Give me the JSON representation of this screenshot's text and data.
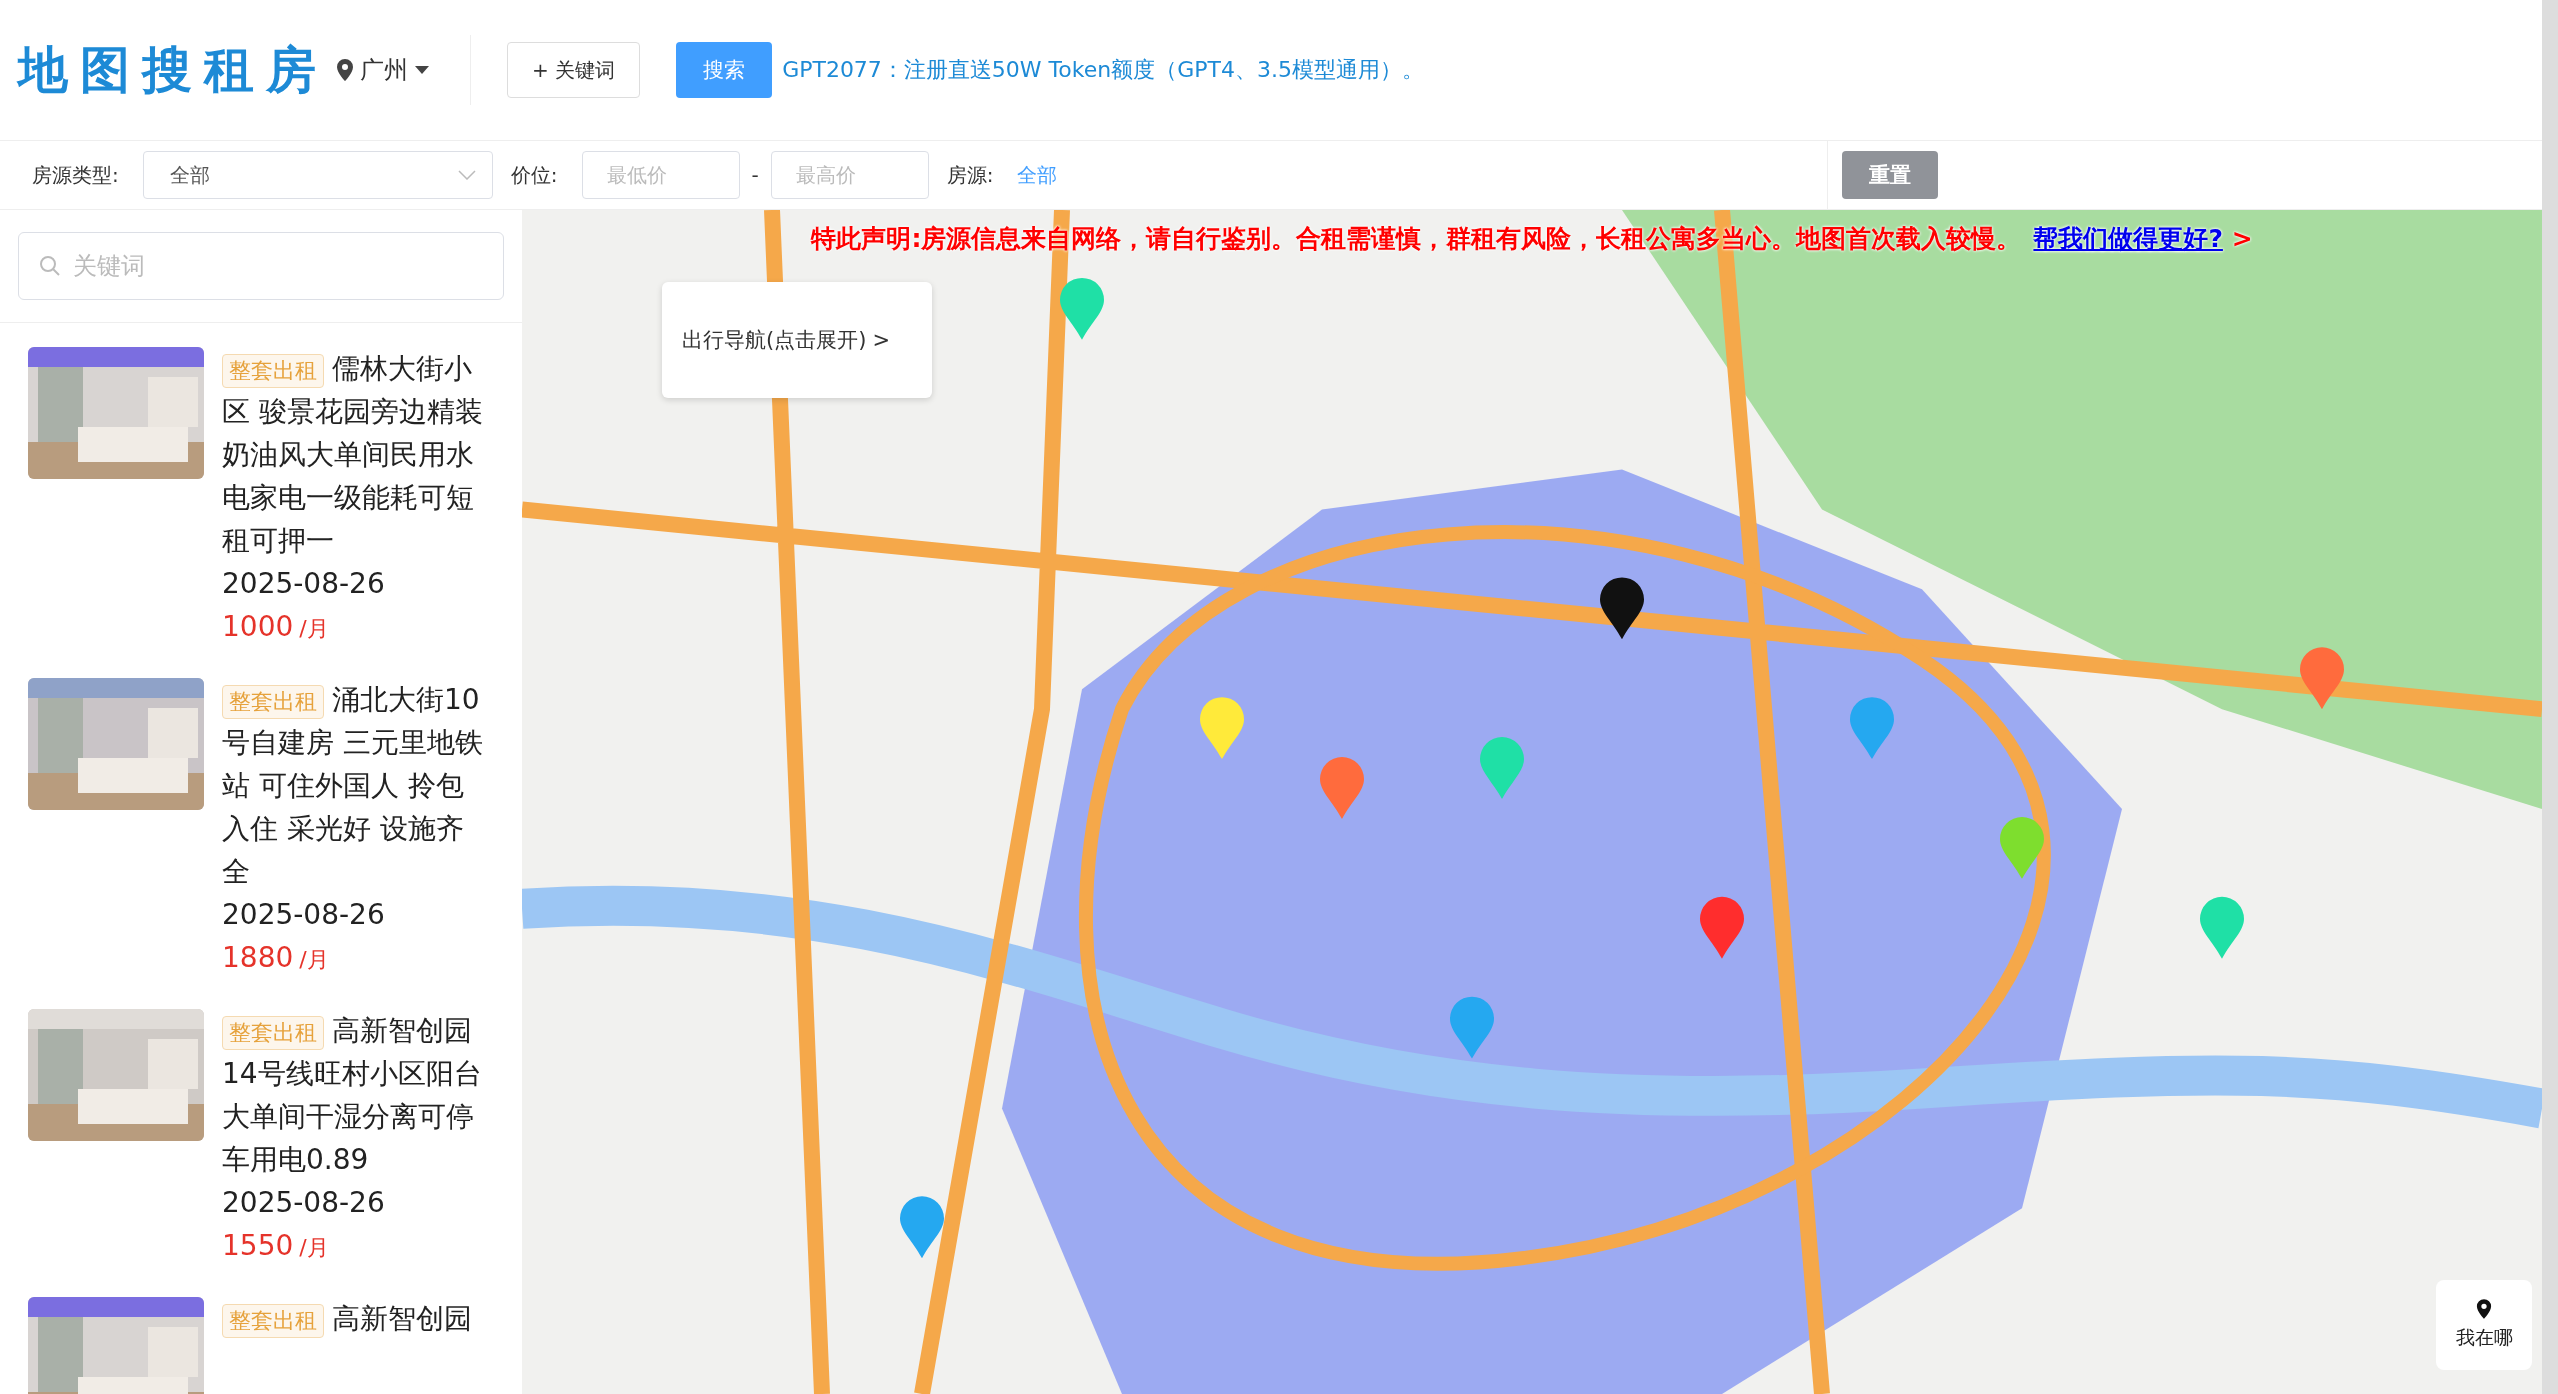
{
  "header": {
    "logo": "地图搜租房",
    "city": "广州",
    "keyword_button": "+ 关键词",
    "search_button": "搜索",
    "promo": "GPT2077：注册直送50W Token额度（GPT4、3.5模型通用）。"
  },
  "filters": {
    "type_label": "房源类型:",
    "type_value": "全部",
    "price_label": "价位:",
    "min_placeholder": "最低价",
    "separator": "-",
    "max_placeholder": "最高价",
    "source_label": "房源:",
    "source_value": "全部",
    "reset_button": "重置"
  },
  "sidebar": {
    "search_placeholder": "关键词",
    "listings": [
      {
        "tag": "整套出租",
        "title": "儒林大街小区 骏景花园旁边精装奶油风大单间民用水电家电一级能耗可短租可押一",
        "date": "2025-08-26",
        "price": "1000",
        "unit": "/月"
      },
      {
        "tag": "整套出租",
        "title": "涌北大街10号自建房 三元里地铁站 可住外国人 拎包入住 采光好 设施齐全",
        "date": "2025-08-26",
        "price": "1880",
        "unit": "/月"
      },
      {
        "tag": "整套出租",
        "title": "高新智创园14号线旺村小区阳台大单间干湿分离可停车用电0.89",
        "date": "2025-08-26",
        "price": "1550",
        "unit": "/月"
      },
      {
        "tag": "整套出租",
        "title": "高新智创园"
      }
    ]
  },
  "map": {
    "notice": "特此声明:房源信息来自网络，请自行鉴别。合租需谨慎，群租有风险，长租公寓多当心。地图首次载入较慢。",
    "notice_link": "帮我们做得更好?",
    "notice_arrow": ">",
    "nav_panel": "出行导航(点击展开)",
    "nav_chevron": ">",
    "locate_button": "我在哪"
  }
}
